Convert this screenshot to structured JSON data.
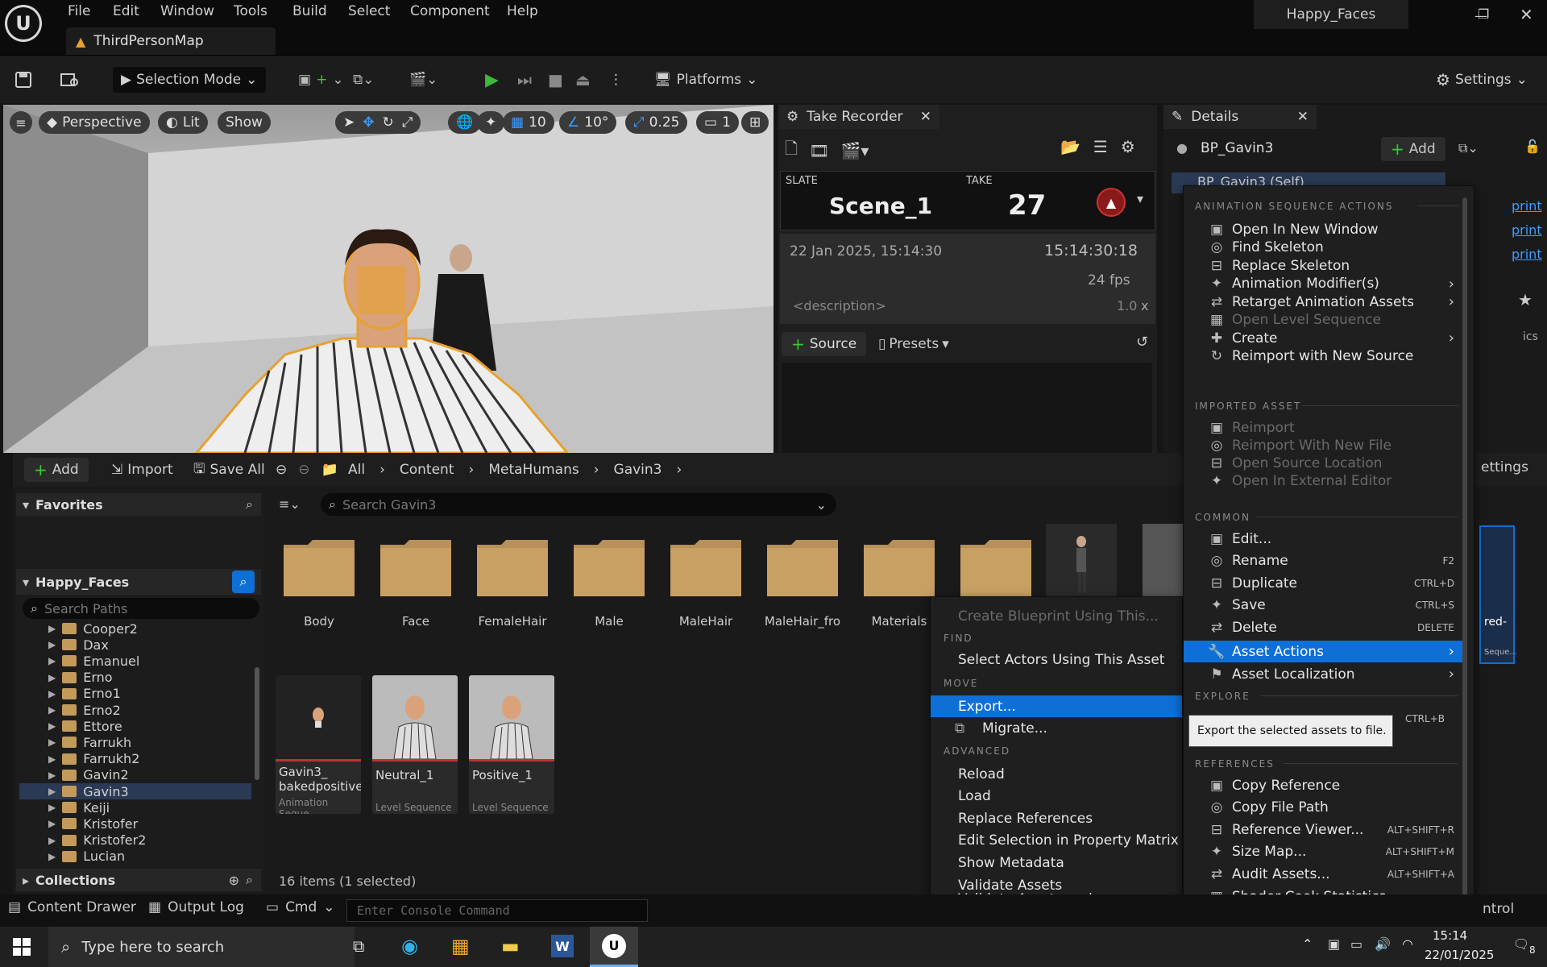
{
  "window": {
    "tab": "ThirdPersonMap",
    "project": "Happy_Faces"
  },
  "menu": [
    "File",
    "Edit",
    "Window",
    "Tools",
    "Build",
    "Select",
    "Component",
    "Help"
  ],
  "toolbar": {
    "mode": "Selection Mode",
    "platforms": "Platforms",
    "settings": "Settings"
  },
  "viewport": {
    "perspective": "Perspective",
    "lit": "Lit",
    "show": "Show",
    "grid": "10",
    "angle": "10°",
    "scale": "0.25",
    "cams": "1"
  },
  "take": {
    "tab": "Take Recorder",
    "slate_label": "SLATE",
    "slate": "Scene_1",
    "take_label": "TAKE",
    "take": "27",
    "date": "22 Jan 2025, 15:14:30",
    "timecode": "15:14:30:18",
    "fps": "24 fps",
    "desc": "<description>",
    "speed": "1.0",
    "x": "x",
    "source": "Source",
    "presets": "Presets"
  },
  "details": {
    "tab": "Details",
    "object": "BP_Gavin3",
    "add": "Add",
    "self": "BP_Gavin3 (Self)",
    "print": "print",
    "ics": "ics"
  },
  "cb": {
    "add": "Add",
    "import": "Import",
    "saveall": "Save All",
    "crumbs": [
      "All",
      "Content",
      "MetaHumans",
      "Gavin3"
    ],
    "favorites": "Favorites",
    "project": "Happy_Faces",
    "search_paths": "Search Paths",
    "search": "Search Gavin3",
    "collections": "Collections",
    "status": "16 items (1 selected)",
    "settings": "ettings",
    "tree": [
      "Cooper2",
      "Dax",
      "Emanuel",
      "Erno",
      "Erno1",
      "Erno2",
      "Ettore",
      "Farrukh",
      "Farrukh2",
      "Gavin2",
      "Gavin3",
      "Keiji",
      "Kristofer",
      "Kristofer2",
      "Lucian"
    ],
    "folders": [
      "Body",
      "Face",
      "FemaleHair",
      "Male",
      "MaleHair",
      "MaleHair_fro",
      "Materials"
    ],
    "assets": [
      {
        "name": "Gavin3_ bakedpositive",
        "type": "Animation Seque..."
      },
      {
        "name": "Neutral_1",
        "type": "Level Sequence"
      },
      {
        "name": "Positive_1",
        "type": "Level Sequence"
      }
    ],
    "side_asset": "red-",
    "side_type": "Seque..."
  },
  "menu_left": {
    "top": "Create Blueprint Using This...",
    "find": "FIND",
    "select": "Select Actors Using This Asset",
    "move": "MOVE",
    "export": "Export...",
    "migrate": "Migrate...",
    "advanced": "ADVANCED",
    "items": [
      "Reload",
      "Load",
      "Replace References",
      "Edit Selection in Property Matrix",
      "Show Metadata",
      "Validate Assets",
      "Validate Assets and Dependencies"
    ]
  },
  "menu_right": {
    "h1": "ANIMATION SEQUENCE ACTIONS",
    "anim": [
      {
        "l": "Open In New Window",
        "d": false,
        "a": false
      },
      {
        "l": "Find Skeleton",
        "d": false,
        "a": false
      },
      {
        "l": "Replace Skeleton",
        "d": false,
        "a": false
      },
      {
        "l": "Animation Modifier(s)",
        "d": false,
        "a": true
      },
      {
        "l": "Retarget Animation Assets",
        "d": false,
        "a": true
      },
      {
        "l": "Open Level Sequence",
        "d": true,
        "a": false
      },
      {
        "l": "Create",
        "d": false,
        "a": true
      },
      {
        "l": "Reimport with New Source",
        "d": false,
        "a": false
      }
    ],
    "h2": "IMPORTED ASSET",
    "imp": [
      "Reimport",
      "Reimport With New File",
      "Open Source Location",
      "Open In External Editor"
    ],
    "h3": "COMMON",
    "common": [
      {
        "l": "Edit...",
        "s": ""
      },
      {
        "l": "Rename",
        "s": "F2"
      },
      {
        "l": "Duplicate",
        "s": "CTRL+D"
      },
      {
        "l": "Save",
        "s": "CTRL+S"
      },
      {
        "l": "Delete",
        "s": "DELETE"
      }
    ],
    "asset_actions": "Asset Actions",
    "asset_loc": "Asset Localization",
    "h4": "EXPLORE",
    "explore_sc": "CTRL+B",
    "tooltip": "Export the selected assets to file.",
    "h5": "REFERENCES",
    "refs": [
      {
        "l": "Copy Reference",
        "s": ""
      },
      {
        "l": "Copy File Path",
        "s": ""
      },
      {
        "l": "Reference Viewer...",
        "s": "ALT+SHIFT+R"
      },
      {
        "l": "Size Map...",
        "s": "ALT+SHIFT+M"
      },
      {
        "l": "Audit Assets...",
        "s": "ALT+SHIFT+A"
      },
      {
        "l": "Shader Cook Statistics...",
        "s": ""
      }
    ]
  },
  "status": {
    "drawer": "Content Drawer",
    "log": "Output Log",
    "cmd": "Cmd",
    "console": "Enter Console Command",
    "control": "ntrol"
  },
  "taskbar": {
    "search": "Type here to search",
    "time": "15:14",
    "date": "22/01/2025",
    "notif": "8"
  }
}
